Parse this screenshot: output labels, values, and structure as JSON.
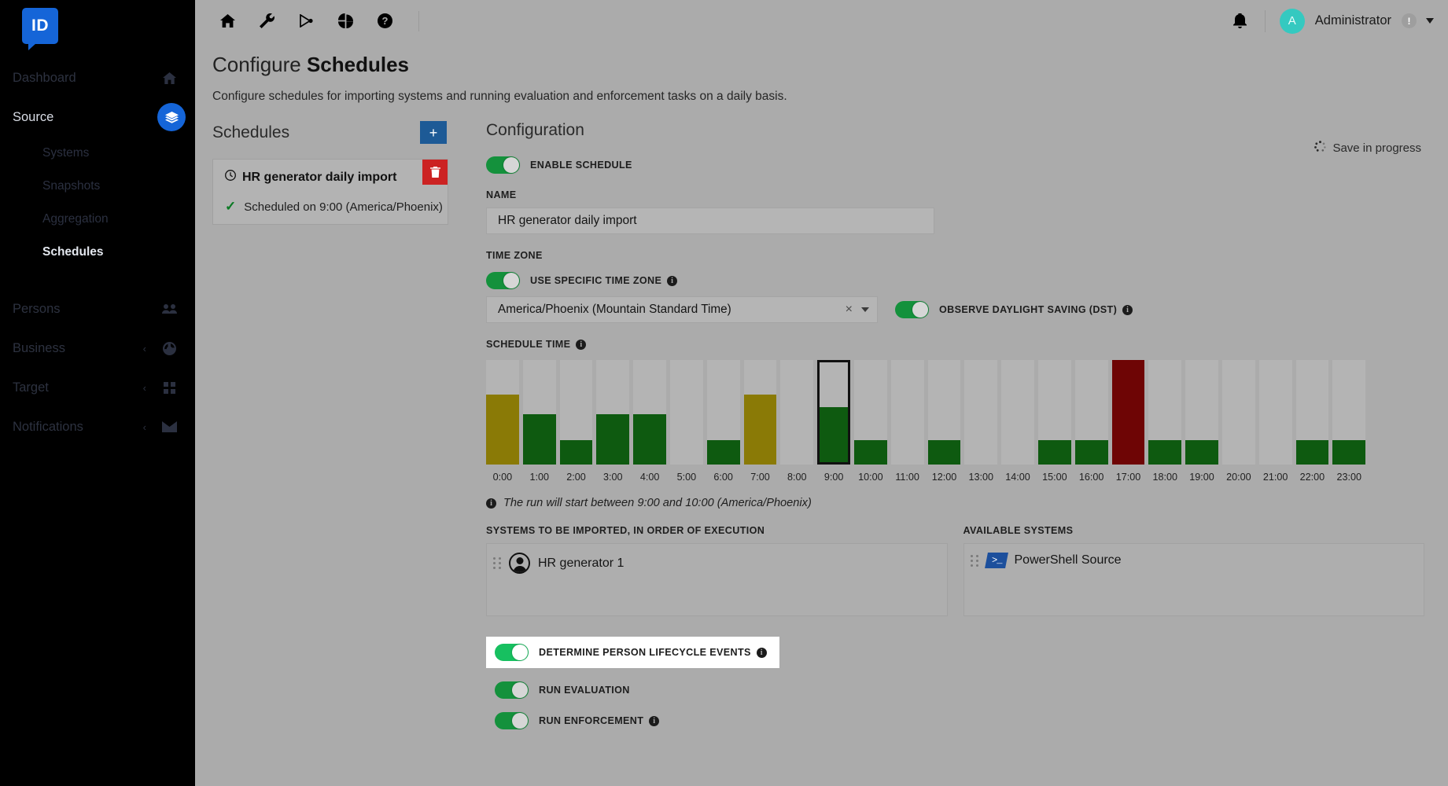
{
  "sidebar": {
    "logo_text": "ID",
    "items": [
      {
        "label": "Dashboard",
        "icon": "home-icon",
        "has_chevron": false,
        "active": false
      },
      {
        "label": "Source",
        "icon": "layers-icon",
        "has_chevron": true,
        "active": true
      },
      {
        "label": "Persons",
        "icon": "people-icon",
        "has_chevron": false,
        "active": false
      },
      {
        "label": "Business",
        "icon": "puzzle-icon",
        "has_chevron": true,
        "active": false
      },
      {
        "label": "Target",
        "icon": "grid-icon",
        "has_chevron": true,
        "active": false
      },
      {
        "label": "Notifications",
        "icon": "envelope-icon",
        "has_chevron": true,
        "active": false
      }
    ],
    "subitems": [
      {
        "label": "Systems",
        "selected": false
      },
      {
        "label": "Snapshots",
        "selected": false
      },
      {
        "label": "Aggregation",
        "selected": false
      },
      {
        "label": "Schedules",
        "selected": true
      }
    ]
  },
  "topbar": {
    "icons": [
      "home-icon",
      "wrench-icon",
      "connector-icon",
      "pie-chart-icon",
      "help-icon"
    ],
    "bell": "bell-icon",
    "avatar_initial": "A",
    "user_name": "Administrator",
    "warning_badge": "!",
    "dropdown": "chevron-down-icon"
  },
  "page": {
    "title_prefix": "Configure ",
    "title_strong": "Schedules",
    "subtitle": "Configure schedules for importing systems and running evaluation and enforcement tasks on a daily basis."
  },
  "schedules_pane": {
    "heading": "Schedules",
    "add_label": "+",
    "cards": [
      {
        "clock_icon": "clock-icon",
        "title": "HR generator daily import",
        "delete_icon": "trash-icon",
        "status_icon": "check-icon",
        "status": "Scheduled on 9:00 (America/Phoenix)"
      }
    ]
  },
  "configuration": {
    "heading": "Configuration",
    "save_status": "Save in progress",
    "save_spinner": "spinner-icon",
    "enable_schedule": {
      "label": "ENABLE SCHEDULE",
      "on": true
    },
    "name": {
      "label": "NAME",
      "value": "HR generator daily import",
      "placeholder": "Name"
    },
    "time_zone": {
      "label": "TIME ZONE",
      "use_specific": {
        "label": "USE SPECIFIC TIME ZONE",
        "on": true,
        "info": "info-icon"
      },
      "selected": "America/Phoenix (Mountain Standard Time)",
      "clear_icon": "clear-icon",
      "dropdown_icon": "chevron-down-icon",
      "dst": {
        "label": "OBSERVE DAYLIGHT SAVING (DST)",
        "on": true,
        "info": "info-icon"
      }
    },
    "schedule_time": {
      "label": "SCHEDULE TIME",
      "info": "info-icon",
      "hint_icon": "info-icon",
      "hint": "The run will start between 9:00 and 10:00 (America/Phoenix)"
    },
    "systems_to_import": {
      "label": "SYSTEMS TO BE IMPORTED, IN ORDER OF EXECUTION",
      "items": [
        {
          "name": "HR generator 1",
          "icon": "person-avatar-icon",
          "handle": "drag-handle-icon"
        }
      ]
    },
    "available_systems": {
      "label": "AVAILABLE SYSTEMS",
      "items": [
        {
          "name": "PowerShell Source",
          "icon": "powershell-icon",
          "handle": "drag-handle-icon"
        }
      ]
    },
    "options": [
      {
        "label": "DETERMINE PERSON LIFECYCLE EVENTS",
        "on": true,
        "info": "info-icon",
        "highlighted": true
      },
      {
        "label": "RUN EVALUATION",
        "on": true,
        "info": null,
        "highlighted": false
      },
      {
        "label": "RUN ENFORCEMENT",
        "on": true,
        "info": "info-icon",
        "highlighted": false
      }
    ]
  },
  "colors": {
    "brand_blue": "#1565d8",
    "toggle_green": "#14913c",
    "toggle_green_bright": "#17c060",
    "bar_green": "#0e5a10",
    "bar_olive": "#8a7a06",
    "bar_red": "#6e0505",
    "bar_track": "#b4b4b4",
    "danger_red": "#cc2222",
    "page_bg": "#ababab",
    "avatar_teal": "#35c9c0"
  },
  "chart_data": {
    "type": "bar",
    "title": "SCHEDULE TIME",
    "xlabel": "",
    "ylabel": "",
    "ylim": [
      0,
      100
    ],
    "grid": false,
    "legend": "none",
    "categories": [
      "0:00",
      "1:00",
      "2:00",
      "3:00",
      "4:00",
      "5:00",
      "6:00",
      "7:00",
      "8:00",
      "9:00",
      "10:00",
      "11:00",
      "12:00",
      "13:00",
      "14:00",
      "15:00",
      "16:00",
      "17:00",
      "18:00",
      "19:00",
      "20:00",
      "21:00",
      "22:00",
      "23:00"
    ],
    "values": [
      67,
      48,
      23,
      48,
      48,
      0,
      23,
      67,
      0,
      55,
      23,
      0,
      23,
      0,
      0,
      23,
      23,
      100,
      23,
      23,
      0,
      0,
      23,
      23
    ],
    "bar_colors": [
      "olive",
      "green",
      "green",
      "green",
      "green",
      "none",
      "green",
      "olive",
      "none",
      "green",
      "green",
      "none",
      "green",
      "none",
      "none",
      "green",
      "green",
      "red",
      "green",
      "green",
      "none",
      "none",
      "green",
      "green"
    ],
    "selected_index": 9,
    "selected_category": "9:00"
  }
}
